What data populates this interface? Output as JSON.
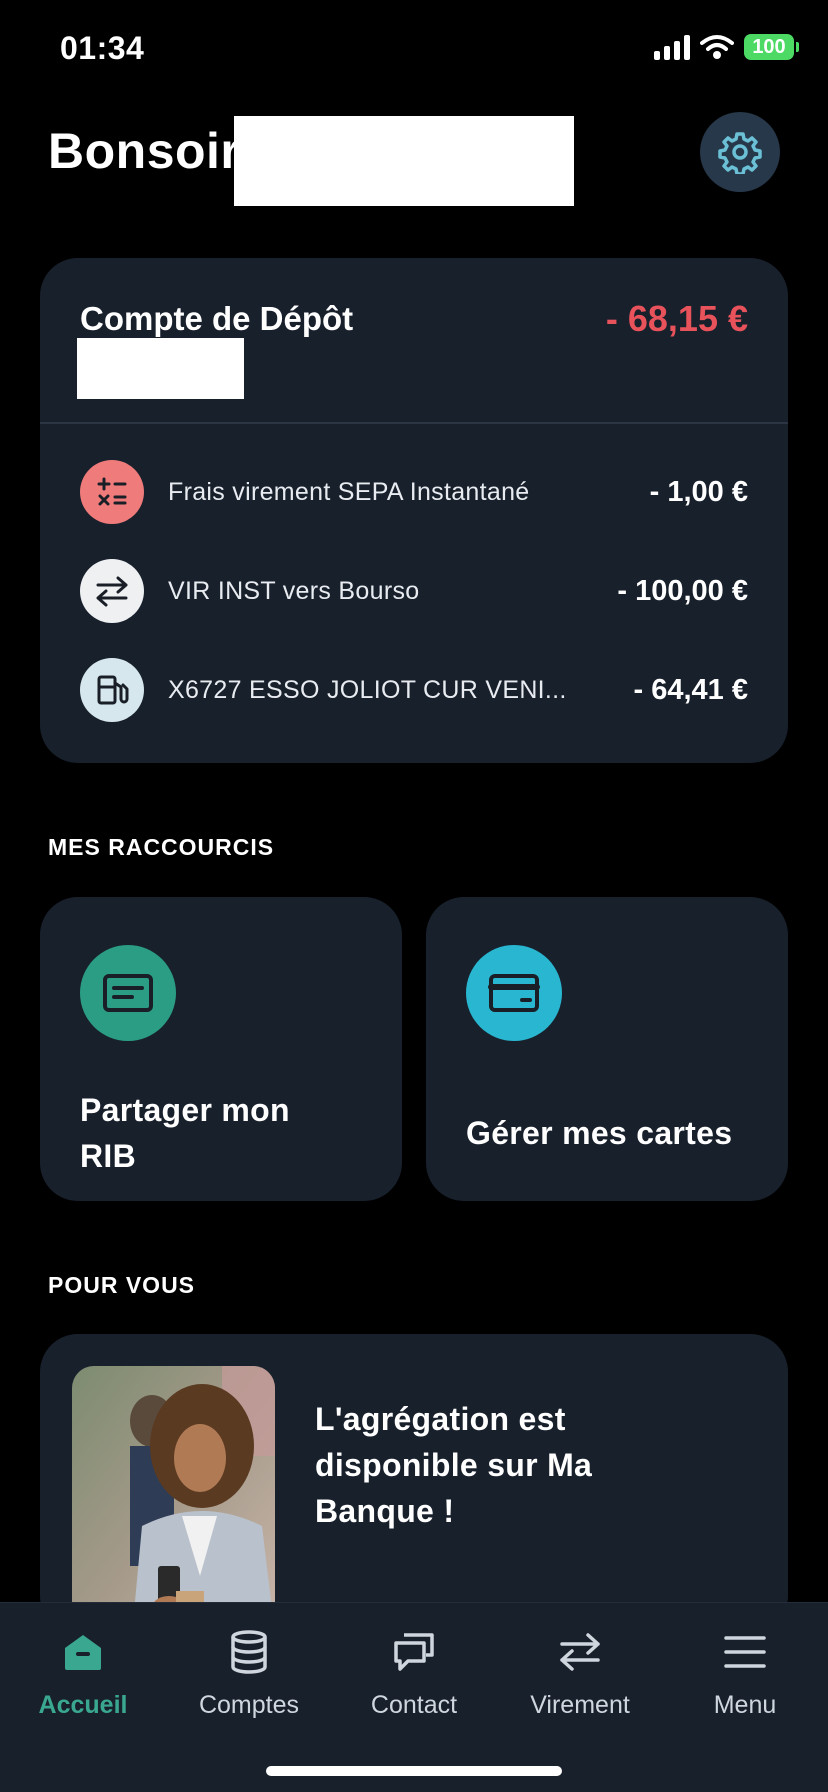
{
  "status_bar": {
    "time": "01:34",
    "battery": "100"
  },
  "header": {
    "greeting": "Bonsoir"
  },
  "account": {
    "title": "Compte de Dépôt",
    "balance": "- 68,15 €",
    "transactions": [
      {
        "label": "Frais virement SEPA Instantané",
        "amount": "- 1,00 €",
        "icon": "calculator-icon",
        "icon_bg": "#ef7b7b"
      },
      {
        "label": "VIR INST vers Bourso",
        "amount": "- 100,00 €",
        "icon": "transfer-arrows-icon",
        "icon_bg": "#eef0f2"
      },
      {
        "label": "X6727 ESSO JOLIOT CUR VENI...",
        "amount": "- 64,41 €",
        "icon": "fuel-pump-icon",
        "icon_bg": "#d6e8ee"
      }
    ]
  },
  "shortcuts": {
    "title": "MES RACCOURCIS",
    "items": [
      {
        "label_line1": "Partager mon",
        "label_line2": "RIB",
        "icon": "rib-card-icon",
        "icon_bg": "#2a9d84"
      },
      {
        "label": "Gérer mes cartes",
        "icon": "credit-card-icon",
        "icon_bg": "#29b6d0"
      }
    ]
  },
  "for_you": {
    "title": "POUR VOUS",
    "promo_line1": "L'agrégation est",
    "promo_line2": "disponible sur Ma",
    "promo_line3": "Banque !"
  },
  "tab_bar": {
    "tabs": [
      {
        "label": "Accueil",
        "icon": "home-icon",
        "active": true
      },
      {
        "label": "Comptes",
        "icon": "database-icon",
        "active": false
      },
      {
        "label": "Contact",
        "icon": "chat-bubbles-icon",
        "active": false
      },
      {
        "label": "Virement",
        "icon": "transfer-arrows-icon",
        "active": false
      },
      {
        "label": "Menu",
        "icon": "hamburger-menu-icon",
        "active": false
      }
    ]
  },
  "colors": {
    "background": "#000000",
    "card": "#18202c",
    "negative_amount": "#e8525a",
    "accent": "#3aa891"
  }
}
